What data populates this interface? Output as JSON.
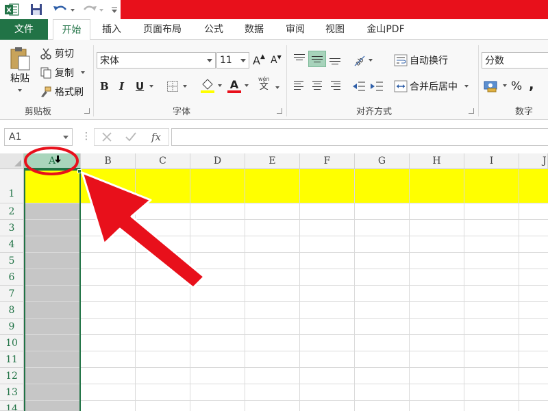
{
  "app": {
    "logo_letter": "X"
  },
  "tabs": [
    {
      "label": "文件",
      "name": "tab-file"
    },
    {
      "label": "开始",
      "name": "tab-home"
    },
    {
      "label": "插入",
      "name": "tab-insert"
    },
    {
      "label": "页面布局",
      "name": "tab-page-layout"
    },
    {
      "label": "公式",
      "name": "tab-formulas"
    },
    {
      "label": "数据",
      "name": "tab-data"
    },
    {
      "label": "审阅",
      "name": "tab-review"
    },
    {
      "label": "视图",
      "name": "tab-view"
    },
    {
      "label": "金山PDF",
      "name": "tab-kingsoft-pdf"
    }
  ],
  "clipboard": {
    "paste": "粘贴",
    "cut": "剪切",
    "copy": "复制",
    "format_painter": "格式刷",
    "group_label": "剪贴板"
  },
  "font": {
    "name": "宋体",
    "size": "11",
    "bold": "B",
    "italic": "I",
    "underline": "U",
    "grow": "A",
    "shrink": "A",
    "color_letter": "A",
    "phonetic_top": "wén",
    "phonetic_bottom": "文",
    "group_label": "字体"
  },
  "alignment": {
    "wrap_text": "自动换行",
    "merge_center": "合并后居中",
    "group_label": "对齐方式"
  },
  "number": {
    "format": "分数",
    "percent": "%",
    "group_label": "数字"
  },
  "formula_bar": {
    "name_box": "A1",
    "fx": "fx",
    "value": ""
  },
  "columns": [
    "A",
    "B",
    "C",
    "D",
    "E",
    "F",
    "G",
    "H",
    "I",
    "J"
  ],
  "rows": [
    "1",
    "2",
    "3",
    "4",
    "5",
    "6",
    "7",
    "8",
    "9",
    "10",
    "11",
    "12",
    "13",
    "14"
  ],
  "colors": {
    "excel_green": "#217346",
    "title_red": "#e8101b",
    "row1_fill": "#ffff00",
    "annotation_red": "#e8101b",
    "selection_gray": "#c6c6c6"
  }
}
